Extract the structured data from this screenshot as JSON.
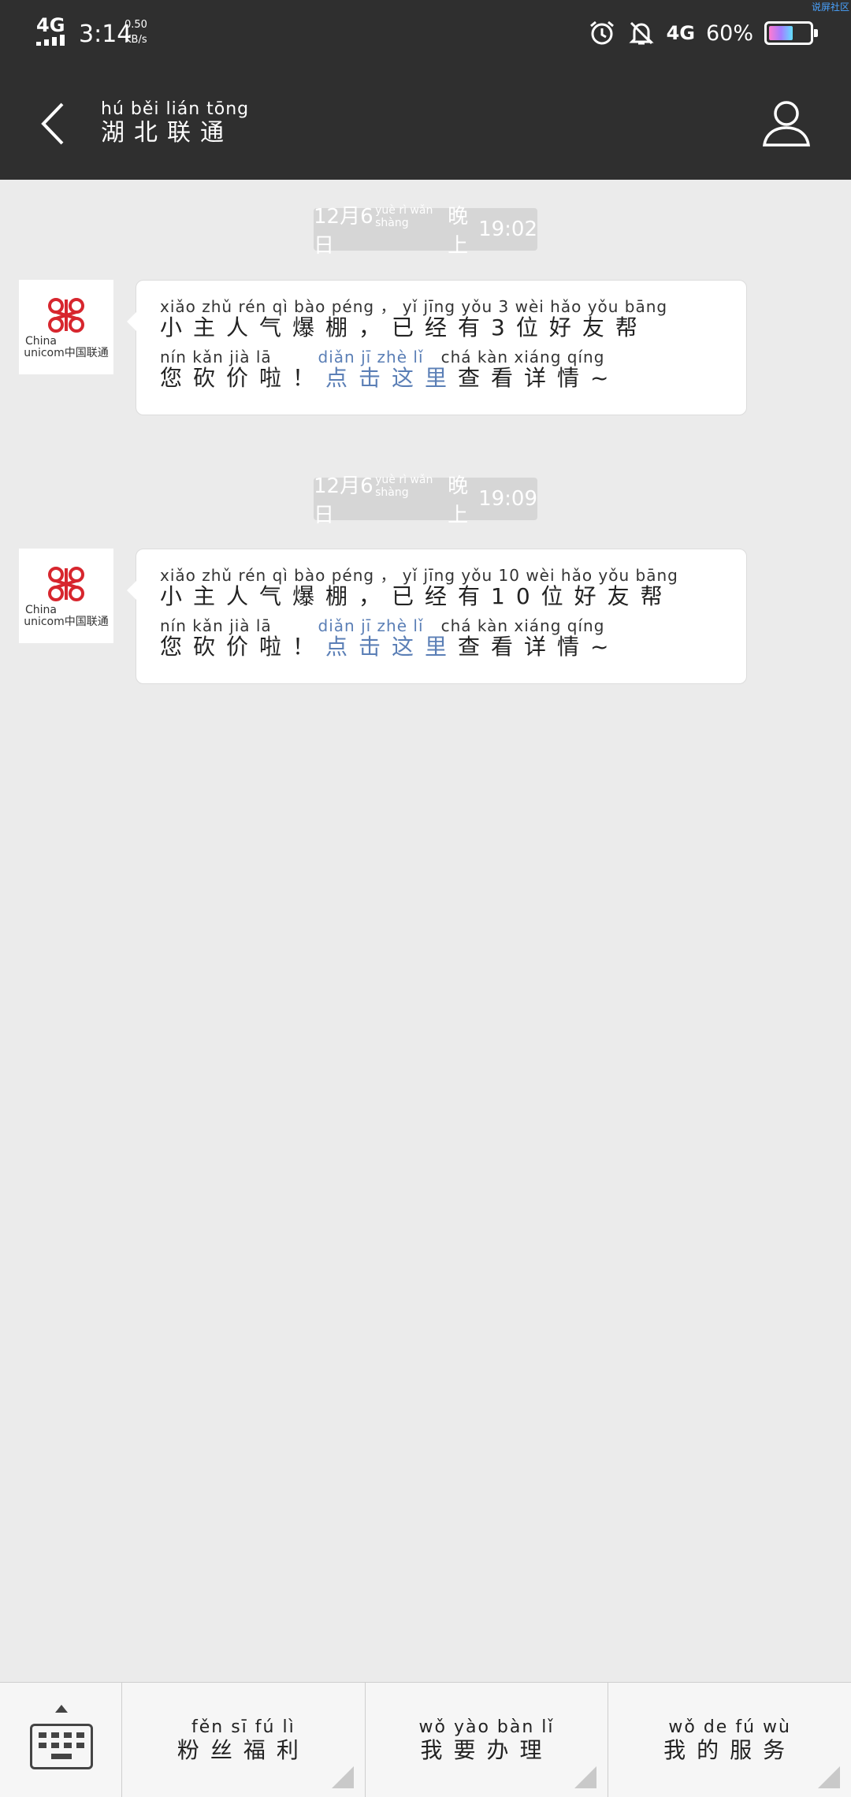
{
  "status_bar": {
    "network": "4G",
    "time": "3:14",
    "speed_value": "0.50",
    "speed_unit": "KB/s",
    "network_type": "4G",
    "battery_percent": "60%",
    "battery_level": 0.6,
    "corner_tag": "说屏社区",
    "icons": [
      "alarm-icon",
      "bell-off-icon",
      "battery-icon",
      "signal-icon"
    ]
  },
  "header": {
    "title_pinyin": "hú běi lián tōng",
    "title": "湖北联通",
    "icons": [
      "back-icon",
      "profile-icon"
    ]
  },
  "messages": [
    {
      "timestamp": {
        "pre": "12月6日",
        "py": "yuè rì wǎn shàng",
        "main": "晚上",
        "time": "19:02"
      },
      "avatar_text_1": "China",
      "avatar_text_2": "unicom中国联通",
      "line1_pinyin": "xiǎo zhǔ rén qì bào péng ， yǐ jīng yǒu 3 wèi hǎo yǒu bāng",
      "line1": "小主人气爆棚，已经有3位好友帮",
      "line2_pinyin_a": "nín kǎn jià lā",
      "line2_a": "您砍价啦！",
      "line2_pinyin_link": "diǎn jī zhè lǐ",
      "line2_link": "点击这里",
      "line2_pinyin_b": "chá kàn xiáng qíng",
      "line2_b": "查看详情~"
    },
    {
      "timestamp": {
        "pre": "12月6日",
        "py": "yuè rì wǎn shàng",
        "main": "晚上",
        "time": "19:09"
      },
      "avatar_text_1": "China",
      "avatar_text_2": "unicom中国联通",
      "line1_pinyin": "xiǎo zhǔ rén qì bào péng ， yǐ jīng yǒu 10 wèi hǎo yǒu bāng",
      "line1": "小主人气爆棚，已经有10位好友帮",
      "line2_pinyin_a": "nín kǎn jià lā",
      "line2_a": "您砍价啦！",
      "line2_pinyin_link": "diǎn jī zhè lǐ",
      "line2_link": "点击这里",
      "line2_pinyin_b": "chá kàn xiáng qíng",
      "line2_b": "查看详情~"
    }
  ],
  "bottom_menu": {
    "items": [
      {
        "pinyin": "fěn sī fú lì",
        "label": "粉丝福利"
      },
      {
        "pinyin": "wǒ yào bàn lǐ",
        "label": "我要办理"
      },
      {
        "pinyin": "wǒ de fú wù",
        "label": "我的服务"
      }
    ]
  },
  "colors": {
    "bar": "#2f2f2f",
    "background": "#ebebeb",
    "link": "#5b7fb6",
    "logo_red": "#d7262e"
  }
}
